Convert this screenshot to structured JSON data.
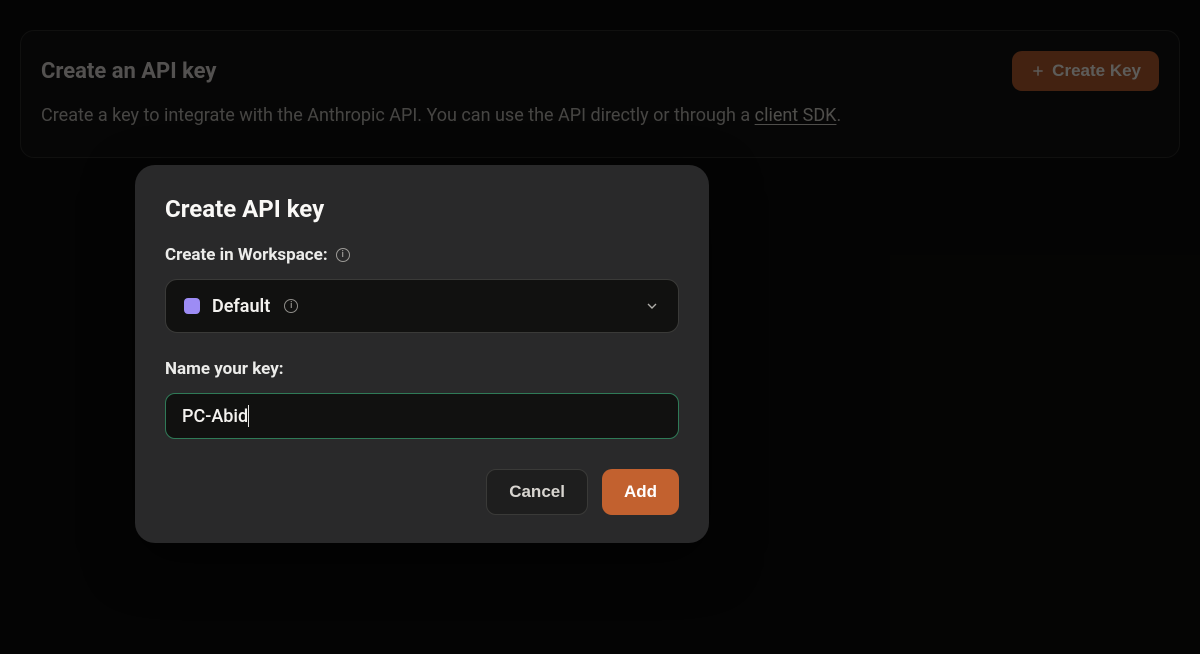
{
  "panel": {
    "title": "Create an API key",
    "description_pre": "Create a key to integrate with the Anthropic API. You can use the API directly or through a ",
    "description_link": "client SDK",
    "description_post": ".",
    "create_button_label": "Create Key"
  },
  "modal": {
    "title": "Create API key",
    "workspace_label": "Create in Workspace:",
    "workspace_selected": "Default",
    "name_label": "Name your key:",
    "name_value": "PC-Abid",
    "buttons": {
      "cancel": "Cancel",
      "add": "Add"
    }
  }
}
